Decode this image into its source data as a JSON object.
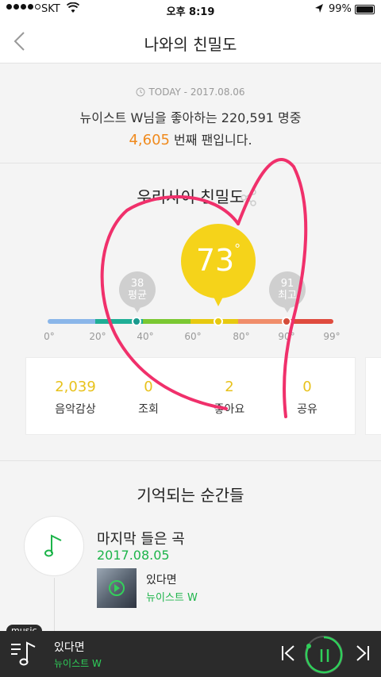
{
  "status_bar": {
    "carrier": "SKT",
    "time": "오후 8:19",
    "battery": "99%"
  },
  "nav": {
    "title": "나와의 친밀도"
  },
  "today": {
    "date_label": "TODAY - 2017.08.06",
    "line1": "뉴이스트 W님을 좋아하는 220,591 명중",
    "rank": "4,605",
    "line2_suffix": " 번째 팬입니다."
  },
  "intimacy": {
    "title": "우리사이 친밀도",
    "score": "73",
    "degree_symbol": "°",
    "average": {
      "value": "38",
      "label": "평균"
    },
    "max": {
      "value": "91",
      "label": "최고"
    },
    "scale_ticks": [
      "0°",
      "20°",
      "40°",
      "60°",
      "80°",
      "90°",
      "99°"
    ],
    "scale_colors": [
      "#8ab6e9",
      "#1fae96",
      "#7bc832",
      "#e7c90f",
      "#f08d6a",
      "#df4b3e"
    ],
    "stats": [
      {
        "value": "2,039",
        "label": "음악감상"
      },
      {
        "value": "0",
        "label": "조회"
      },
      {
        "value": "2",
        "label": "좋아요"
      },
      {
        "value": "0",
        "label": "공유"
      }
    ]
  },
  "moments": {
    "title": "기억되는 순간들",
    "item_title": "마지막 들은 곡",
    "item_date": "2017.08.05",
    "song_title": "있다면",
    "song_artist": "뉴이스트 W"
  },
  "player": {
    "tag": "music",
    "title": "있다면",
    "artist": "뉴이스트 W"
  },
  "colors": {
    "accent_green": "#1db44a",
    "rank_orange": "#f08a1d",
    "score_yellow": "#f5d31a",
    "doodle_pink": "#f0306b"
  }
}
